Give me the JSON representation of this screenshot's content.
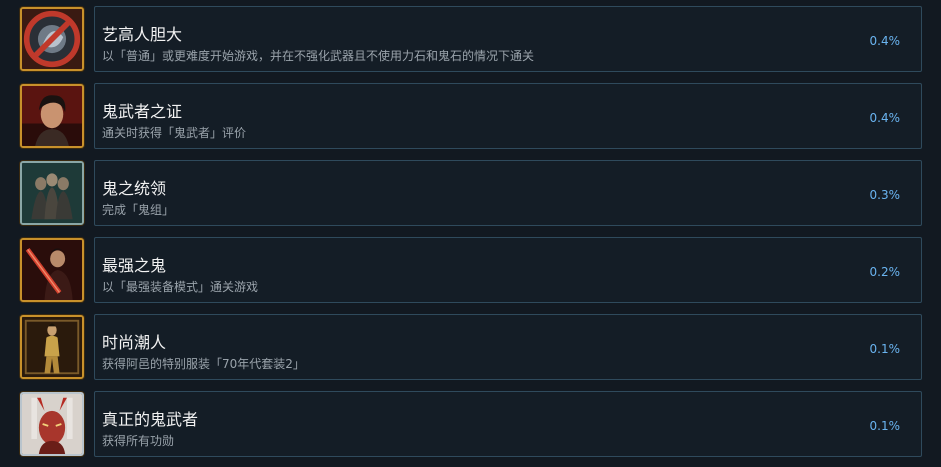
{
  "achievements": [
    {
      "icon": "crossed-dragon-emblem-icon",
      "title": "艺高人胆大",
      "description": "以「普通」或更难度开始游戏，并在不强化武器且不使用力石和鬼石的情况下通关",
      "percent": "0.4%"
    },
    {
      "icon": "warrior-portrait-icon",
      "title": "鬼武者之证",
      "description": "通关时获得「鬼武者」评价",
      "percent": "0.4%"
    },
    {
      "icon": "oni-group-icon",
      "title": "鬼之统领",
      "description": "完成「鬼组」",
      "percent": "0.3%"
    },
    {
      "icon": "sword-wielder-icon",
      "title": "最强之鬼",
      "description": "以「最强装备模式」通关游戏",
      "percent": "0.2%"
    },
    {
      "icon": "costume-figure-icon",
      "title": "时尚潮人",
      "description": "获得阿邑的特别服装「70年代套装2」",
      "percent": "0.1%"
    },
    {
      "icon": "true-onimusha-icon",
      "title": "真正的鬼武者",
      "description": "获得所有功勋",
      "percent": "0.1%"
    }
  ]
}
